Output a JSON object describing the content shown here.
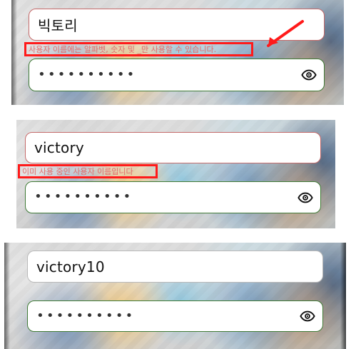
{
  "panels": [
    {
      "username": {
        "value": "빅토리"
      },
      "error": {
        "text": "사용자 이름에는 알파벳, 숫자 및 _만 사용할 수 있습니다."
      },
      "password": {
        "value": "••••••••••"
      }
    },
    {
      "username": {
        "value": "victory"
      },
      "error": {
        "text": "이미 사용 중인 사용자 이름입니다"
      },
      "password": {
        "value": "••••••••••"
      }
    },
    {
      "username": {
        "value": "victory10"
      },
      "password": {
        "value": "••••••••••"
      }
    }
  ],
  "icons": {
    "visibility": "eye-icon",
    "annotation_arrow": "arrow-icon"
  },
  "colors": {
    "error_outline": "#ff1a1a",
    "error_text": "#e36b6b",
    "username_border_error": "#c56a6a",
    "password_border": "#3f7a35"
  }
}
